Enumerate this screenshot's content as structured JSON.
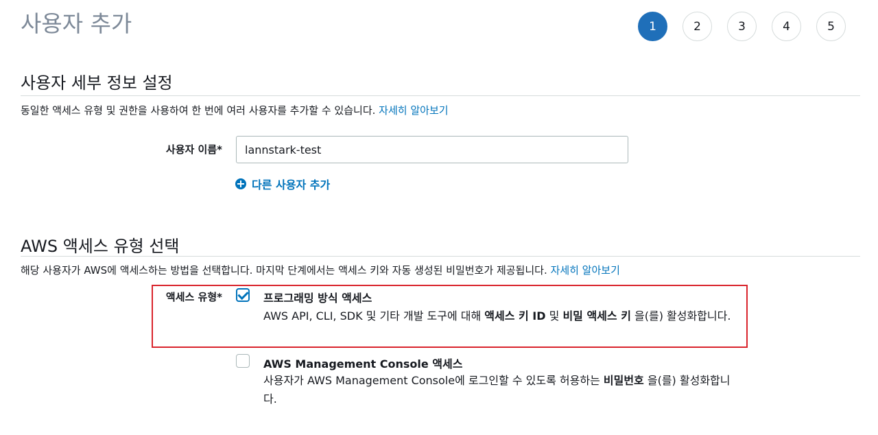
{
  "page": {
    "title": "사용자 추가"
  },
  "steps": [
    "1",
    "2",
    "3",
    "4",
    "5"
  ],
  "user_details": {
    "heading": "사용자 세부 정보 설정",
    "description": "동일한 액세스 유형 및 권한을 사용하여 한 번에 여러 사용자를 추가할 수 있습니다.",
    "learn_more": "자세히 알아보기",
    "username_label": "사용자 이름*",
    "username_value": "lannstark-test",
    "add_another_user": "다른 사용자 추가"
  },
  "access_type": {
    "heading": "AWS 액세스 유형 선택",
    "description": "해당 사용자가 AWS에 액세스하는 방법을 선택합니다. 마지막 단계에서는 액세스 키와 자동 생성된 비밀번호가 제공됩니다.",
    "learn_more": "자세히 알아보기",
    "label": "액세스 유형*",
    "options": [
      {
        "title": "프로그래밍 방식 액세스",
        "checked": true,
        "desc_pre": "AWS API, CLI, SDK 및 기타 개발 도구에 대해 ",
        "bold1": "액세스 키 ID",
        "desc_mid": " 및 ",
        "bold2": "비밀 액세스 키",
        "desc_post": " 을(를) 활성화합니다."
      },
      {
        "title": "AWS Management Console 액세스",
        "checked": false,
        "desc_pre": "사용자가 AWS Management Console에 로그인할 수 있도록 허용하는 ",
        "bold1": "비밀번호",
        "desc_post": " 을(를) 활성화합니다."
      }
    ]
  },
  "colors": {
    "accent": "#0073bb",
    "active_step": "#1f6fb9",
    "highlight_border": "#d9232b"
  }
}
